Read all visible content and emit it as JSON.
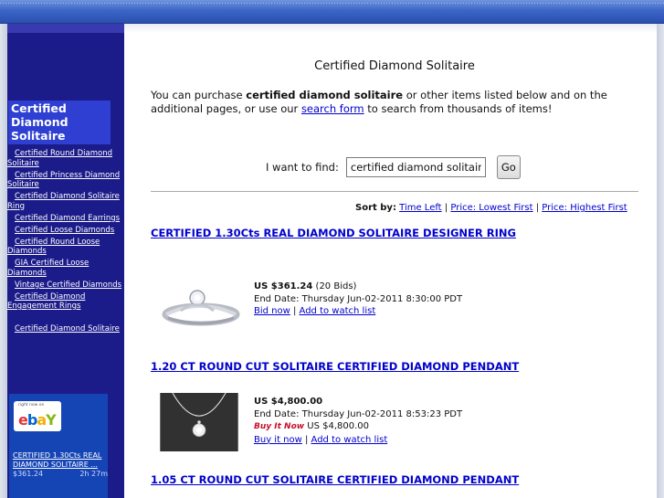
{
  "sidebar": {
    "title": "Certified Diamond Solitaire",
    "links": [
      "Certified Round Diamond Solitaire",
      "Certified Princess Diamond Solitaire",
      "Certified Diamond Solitaire Ring",
      "Certified Diamond Earrings",
      "Certified Loose Diamonds",
      "Certified Round Loose Diamonds",
      "GIA Certified Loose Diamonds",
      "Vintage Certified Diamonds",
      "Certified Diamond Engagement Rings",
      "Certified Diamond Solitaire"
    ],
    "ebay": {
      "tagline": "right now on",
      "logo_letters": [
        "e",
        "b",
        "a",
        "Y"
      ],
      "item_title": "CERTIFIED 1.30Cts REAL DIAMOND SOLITAIRE ...",
      "item_price": "$361.24",
      "item_time": "2h 27m"
    }
  },
  "main": {
    "title": "Certified Diamond Solitaire",
    "intro": {
      "p1": "You can purchase ",
      "bold": "certified diamond solitaire",
      "p2": " or other items listed below and on the additional pages, or use our ",
      "link": "search form",
      "p3": " to search from thousands of items!"
    },
    "search": {
      "label": "I want to find:",
      "value": "certified diamond solitaire",
      "button": "Go"
    },
    "sort": {
      "label": "Sort by:",
      "options": [
        "Time Left",
        "Price: Lowest First",
        "Price: Highest First"
      ],
      "separator": "|"
    },
    "listings": [
      {
        "title": "CERTIFIED 1.30Cts REAL DIAMOND SOLITAIRE DESIGNER RING",
        "price": "US $361.24",
        "bids": "(20 Bids)",
        "end_date": "End Date: Thursday Jun-02-2011 8:30:00 PDT",
        "action": "Bid now",
        "watch": "Add to watch list"
      },
      {
        "title": "1.20 CT ROUND CUT SOLITAIRE CERTIFIED DIAMOND PENDANT",
        "price": "US $4,800.00",
        "end_date": "End Date: Thursday Jun-02-2011 8:53:23 PDT",
        "buy_it_now_logo": "Buy It Now",
        "buy_it_now_price": "US $4,800.00",
        "action": "Buy it now",
        "watch": "Add to watch list"
      },
      {
        "title": "1.05 CT ROUND CUT SOLITAIRE CERTIFIED DIAMOND PENDANT"
      }
    ]
  },
  "colors": {
    "sidebar_bg": "#1b1b8a",
    "sidebar_title_bg": "#2e3fd1",
    "link": "#0000cc",
    "topbar": "#3d66c6"
  }
}
